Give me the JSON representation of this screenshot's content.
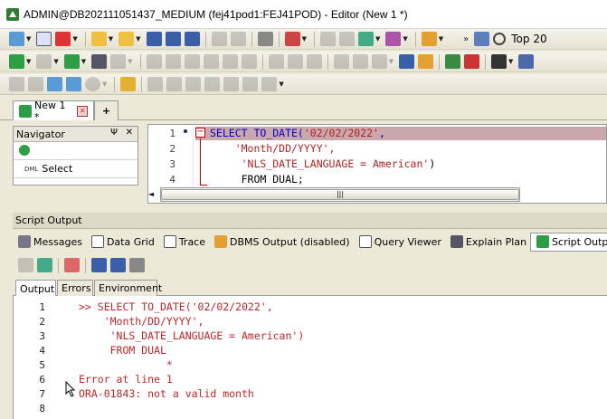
{
  "window": {
    "title": "ADMIN@DB202111051437_MEDIUM (fej41pod1:FEJ41POD) - Editor (New 1 *)"
  },
  "toolbar": {
    "top_label": "Top 20"
  },
  "doc_tabs": [
    {
      "label": "New 1 *"
    },
    {
      "label": "+"
    }
  ],
  "navigator": {
    "title": "Navigator",
    "pin_glyph": "Ψ",
    "close_glyph": "✕",
    "item": "Select",
    "item_prefix": "DML"
  },
  "editor": {
    "lines": [
      {
        "num": "1",
        "text": "SELECT TO_DATE('02/02/2022',"
      },
      {
        "num": "2",
        "text": "    'Month/DD/YYYY',"
      },
      {
        "num": "3",
        "text": "     'NLS_DATE_LANGUAGE = American')"
      },
      {
        "num": "4",
        "text": "     FROM DUAL;"
      }
    ]
  },
  "script_output": {
    "title": "Script Output",
    "tabs": [
      "Messages",
      "Data Grid",
      "Trace",
      "DBMS Output (disabled)",
      "Query Viewer",
      "Explain Plan",
      "Script Output"
    ],
    "output_tabs": [
      "Output",
      "Errors",
      "Environment"
    ],
    "lines": [
      {
        "num": "1",
        "text": ">> SELECT TO_DATE('02/02/2022',"
      },
      {
        "num": "2",
        "text": "    'Month/DD/YYYY',"
      },
      {
        "num": "3",
        "text": "     'NLS_DATE_LANGUAGE = American')"
      },
      {
        "num": "4",
        "text": "     FROM DUAL"
      },
      {
        "num": "5",
        "text": "              *"
      },
      {
        "num": "6",
        "text": "Error at line 1"
      },
      {
        "num": "7",
        "text": "ORA-01843: not a valid month"
      },
      {
        "num": "8",
        "text": ""
      }
    ]
  },
  "colors": {
    "keyword": "#0000cc",
    "string": "#b22222",
    "error": "#c0262a",
    "highlight": "#c9a7ad",
    "accent": "#3b6fc2"
  }
}
